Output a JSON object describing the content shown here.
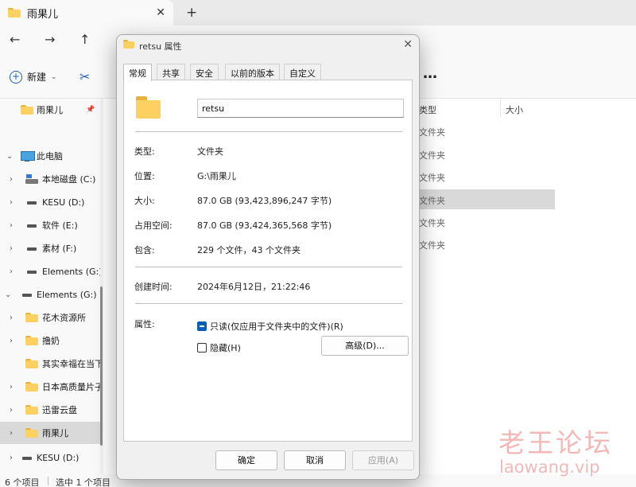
{
  "explorer": {
    "tab_title": "雨果儿",
    "tab_close": "✕",
    "new_tab": "+",
    "nav": {
      "back": "←",
      "forward": "→",
      "up": "↑"
    },
    "cmd": {
      "new_label": "新建",
      "new_chevron": "⌄",
      "cut_icon": "✂",
      "more": "…"
    },
    "columns": {
      "type": "类型",
      "size": "大小"
    },
    "row_types": [
      "文件夹",
      "文件夹",
      "文件夹",
      "文件夹",
      "文件夹",
      "文件夹"
    ],
    "sidebar": [
      {
        "label": "雨果儿",
        "pinned": "📌"
      },
      {
        "label": "此电脑"
      },
      {
        "label": "本地磁盘 (C:)"
      },
      {
        "label": "KESU (D:)"
      },
      {
        "label": "软件 (E:)"
      },
      {
        "label": "素材 (F:)"
      },
      {
        "label": "Elements (G:)"
      },
      {
        "label": "Elements (G:)"
      },
      {
        "label": "花木资源所"
      },
      {
        "label": "撸奶"
      },
      {
        "label": "其实幸福在当下"
      },
      {
        "label": "日本高质量片子"
      },
      {
        "label": "迅雷云盘"
      },
      {
        "label": "雨果儿"
      },
      {
        "label": "KESU (D:)"
      }
    ],
    "status": {
      "count": "6 个项目",
      "selected": "选中 1 个项目"
    }
  },
  "dialog": {
    "title": "retsu 属性",
    "close": "✕",
    "tabs": [
      "常规",
      "共享",
      "安全",
      "以前的版本",
      "自定义"
    ],
    "name_value": "retsu",
    "props": [
      {
        "label": "类型:",
        "value": "文件夹"
      },
      {
        "label": "位置:",
        "value": "G:\\雨果儿"
      },
      {
        "label": "大小:",
        "value": "87.0 GB (93,423,896,247 字节)"
      },
      {
        "label": "占用空间:",
        "value": "87.0 GB (93,424,365,568 字节)"
      },
      {
        "label": "包含:",
        "value": "229 个文件，43 个文件夹"
      },
      {
        "label": "创建时间:",
        "value": "2024年6月12日，21:22:46"
      }
    ],
    "attributes_label": "属性:",
    "readonly_label": "只读(仅应用于文件夹中的文件)(R)",
    "hidden_label": "隐藏(H)",
    "advanced_label": "高级(D)...",
    "ok_label": "确定",
    "cancel_label": "取消",
    "apply_label": "应用(A)"
  },
  "watermark": {
    "cn": "老王论坛",
    "en": "laowang.vip"
  }
}
